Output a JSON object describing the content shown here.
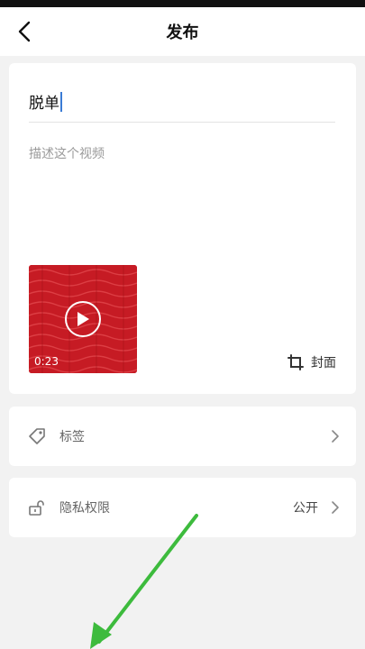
{
  "header": {
    "title": "发布"
  },
  "form": {
    "title_value": "脱单",
    "description_placeholder": "描述这个视频"
  },
  "video": {
    "duration": "0:23"
  },
  "cover": {
    "label": "封面"
  },
  "rows": {
    "tags": {
      "label": "标签"
    },
    "privacy": {
      "label": "隐私权限",
      "value": "公开"
    }
  },
  "colors": {
    "accent_caret": "#3a7bd5",
    "thumbnail_red": "#c61b24",
    "annotation_arrow": "#3dbb3d"
  },
  "icons": {
    "back": "back-arrow-icon",
    "play": "play-icon",
    "crop": "crop-icon",
    "tag": "tag-icon",
    "lock": "unlock-icon",
    "chevron": "chevron-right-icon"
  }
}
